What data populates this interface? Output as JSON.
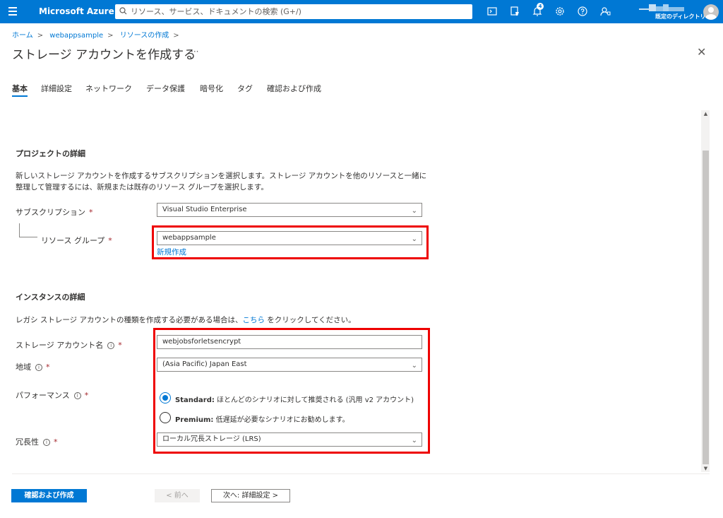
{
  "topbar": {
    "brand": "Microsoft Azure",
    "search_placeholder": "リソース、サービス、ドキュメントの検索 (G+/)",
    "notification_count": "4",
    "directory_label": "既定のディレクトリ",
    "color": "#0078d4"
  },
  "breadcrumb": [
    "ホーム",
    "webappsample",
    "リソースの作成"
  ],
  "page": {
    "title": "ストレージ アカウントを作成する",
    "more": "···",
    "close": "✕"
  },
  "tabs": [
    "基本",
    "詳細設定",
    "ネットワーク",
    "データ保護",
    "暗号化",
    "タグ",
    "確認および作成"
  ],
  "project": {
    "heading": "プロジェクトの詳細",
    "description": "新しいストレージ アカウントを作成するサブスクリプションを選択します。ストレージ アカウントを他のリソースと一緒に整理して管理するには、新規または既存のリソース グループを選択します。",
    "subscription_label": "サブスクリプション",
    "subscription_value": "Visual Studio Enterprise",
    "resource_group_label": "リソース グループ",
    "resource_group_value": "webappsample",
    "create_new": "新規作成"
  },
  "instance": {
    "heading": "インスタンスの詳細",
    "legacy_text_before": "レガシ ストレージ アカウントの種類を作成する必要がある場合は、",
    "legacy_link": "こちら",
    "legacy_text_after": " をクリックしてください。",
    "account_name_label": "ストレージ アカウント名",
    "account_name_value": "webjobsforletsencrypt",
    "region_label": "地域",
    "region_value": "(Asia Pacific) Japan East",
    "performance_label": "パフォーマンス",
    "standard_bold": "Standard:",
    "standard_text": " ほとんどのシナリオに対して推奨される (汎用 v2 アカウント)",
    "premium_bold": "Premium:",
    "premium_text": " 低遅延が必要なシナリオにお勧めします。",
    "redundancy_label": "冗長性",
    "redundancy_value": "ローカル冗長ストレージ (LRS)"
  },
  "required_mark": "*",
  "info_mark": "i",
  "footer": {
    "review_create": "確認および作成",
    "previous": "< 前へ",
    "next": "次へ: 詳細設定 >"
  }
}
